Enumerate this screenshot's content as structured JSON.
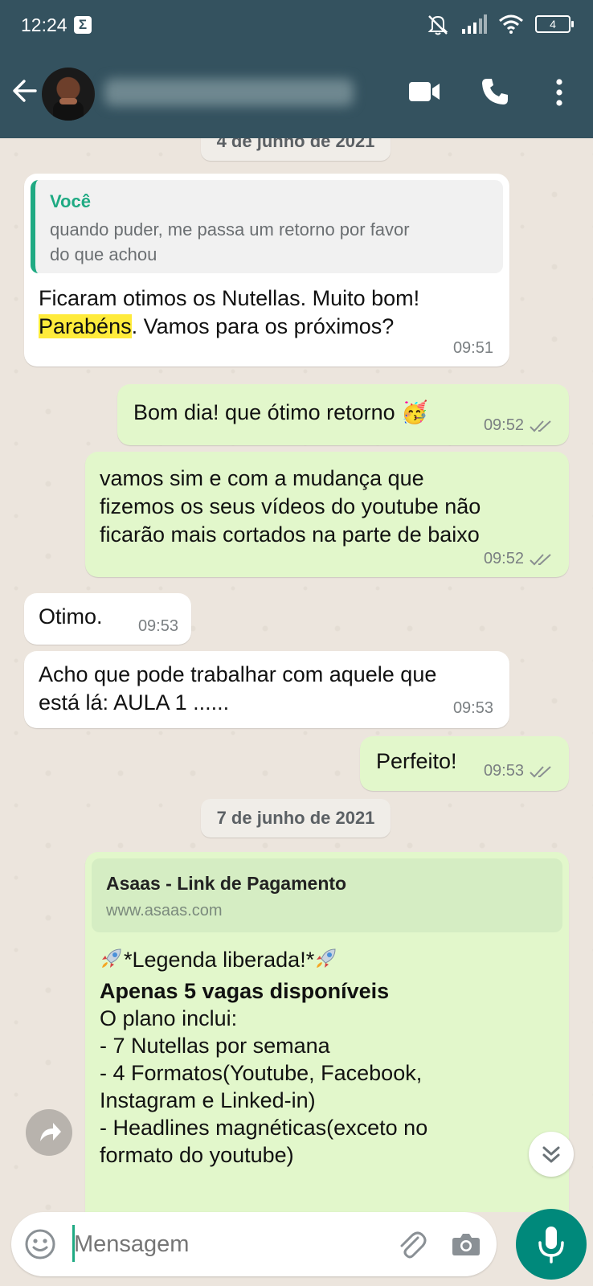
{
  "status_bar": {
    "time": "12:24",
    "notif_glyph": "Σ",
    "battery": "4"
  },
  "header": {
    "contact_name": ""
  },
  "dates": {
    "first": "4 de junho de 2021",
    "second": "7 de junho de 2021"
  },
  "messages": {
    "m1": {
      "quote_author": "Você",
      "quote_line1": "quando puder, me passa um retorno por favor",
      "quote_line2": "do que achou",
      "line1": "Ficaram otimos os Nutellas. Muito bom!",
      "highlight": "Parabéns",
      "line2_rest": ". Vamos para os próximos?",
      "time": "09:51"
    },
    "m2": {
      "text": "Bom dia! que ótimo retorno 🥳",
      "time": "09:52"
    },
    "m3": {
      "line1": "vamos sim e com a mudança que",
      "line2": "fizemos os seus vídeos do youtube não",
      "line3": "ficarão mais cortados na parte de baixo",
      "time": "09:52"
    },
    "m4": {
      "text": "Otimo.",
      "time": "09:53"
    },
    "m5": {
      "line1": "Acho que pode trabalhar com  aquele que",
      "line2": "está lá: AULA 1 ......",
      "time": "09:53"
    },
    "m6": {
      "text": "Perfeito!",
      "time": "09:53"
    },
    "m7": {
      "link_title": "Asaas - Link de Pagamento",
      "link_url": "www.asaas.com",
      "caption": "*Legenda liberada!*",
      "bold_line": "Apenas 5 vagas disponíveis",
      "l1": "O plano inclui:",
      "l2": "- 7 Nutellas por semana",
      "l3": "- 4 Formatos(Youtube, Facebook,",
      "l4": "Instagram e Linked-in)",
      "l5": "- Headlines magnéticas(exceto no",
      "l6": "formato do youtube)"
    }
  },
  "composer": {
    "placeholder": "Mensagem"
  },
  "colors": {
    "header": "#34525f",
    "outgoing": "#e2f7cb",
    "incoming": "#ffffff",
    "accent": "#00897b",
    "highlight": "#ffeb3b"
  }
}
